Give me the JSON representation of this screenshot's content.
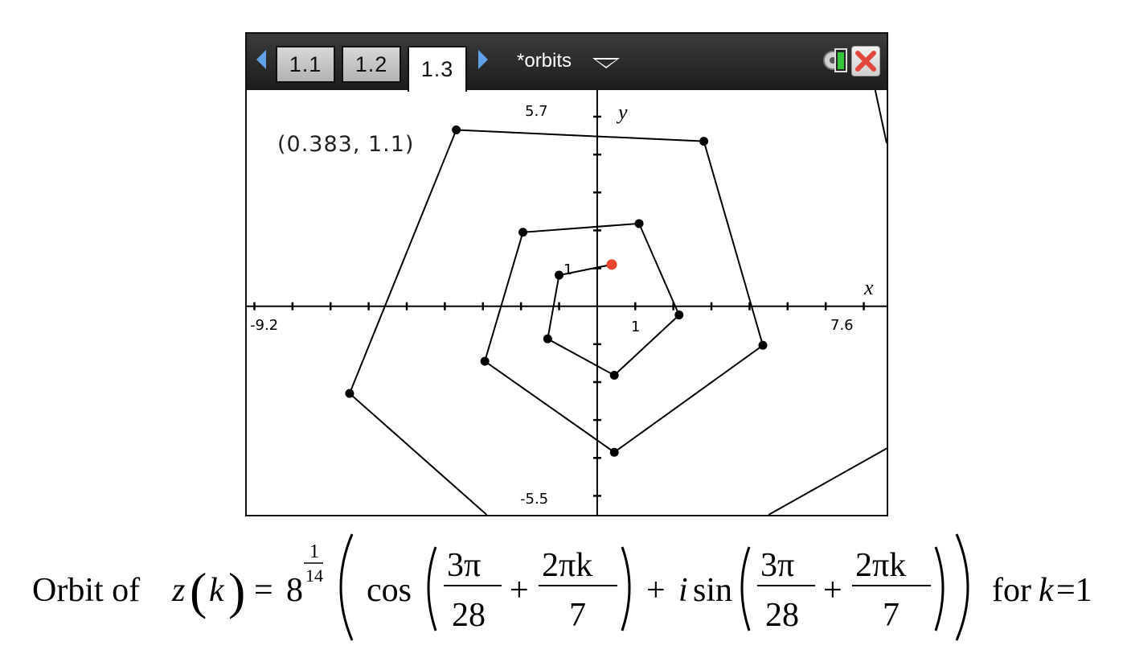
{
  "tabs": [
    {
      "label": "1.1",
      "active": false
    },
    {
      "label": "1.2",
      "active": false
    },
    {
      "label": "1.3",
      "active": true
    }
  ],
  "document_title": "*orbits",
  "icons": {
    "prev": "left-arrow-icon",
    "next": "right-arrow-icon",
    "menu": "chevron-down-icon",
    "status": "gear-battery-icon",
    "close": "close-icon"
  },
  "graph": {
    "window": {
      "xmin": "-9.2",
      "xmax": "7.6",
      "ymin": "-5.5",
      "ymax": "5.7"
    },
    "axis_labels": {
      "x": "x",
      "y": "y"
    },
    "tick_labels": {
      "x": "1",
      "y": "1"
    },
    "coordinate_readout": "(0.383, 1.1)",
    "colors": {
      "orbit": "#000000",
      "current_point": "#e8462e"
    }
  },
  "chart_data": {
    "type": "line",
    "series": [
      {
        "x": [
          0.383,
          -1.0,
          -1.3,
          0.45,
          2.15,
          1.1,
          -1.95,
          -2.95,
          0.45,
          4.35,
          2.8,
          -3.7,
          -6.5,
          -2.9
        ],
        "y": [
          1.1,
          0.82,
          -0.86,
          -1.82,
          -0.23,
          2.18,
          1.95,
          -1.45,
          -3.85,
          -1.03,
          4.35,
          4.65,
          -2.3,
          -5.5
        ]
      },
      {
        "x": [
          7.6,
          7.3
        ],
        "y": [
          4.3,
          5.7
        ]
      },
      {
        "x": [
          4.5,
          7.6
        ],
        "y": [
          -5.5,
          -3.75
        ]
      }
    ],
    "current_point": {
      "x": 0.383,
      "y": 1.1
    },
    "xlim": [
      -9.2,
      7.6
    ],
    "ylim": [
      -5.5,
      5.7
    ],
    "xlabel": "x",
    "ylabel": "y",
    "grid": false
  },
  "caption": {
    "prefix": "Orbit of",
    "z": "z",
    "k": "k",
    "equals": "=",
    "base": "8",
    "exp_num": "1",
    "exp_den": "14",
    "cos": "cos",
    "i": "i",
    "sin": "sin",
    "frac1_num": "3π",
    "frac1_den": "28",
    "plus": "+",
    "frac2_num": "2πk",
    "frac2_den": "7",
    "suffix_for": "for",
    "suffix_k": "k",
    "suffix_eq": "=1"
  }
}
